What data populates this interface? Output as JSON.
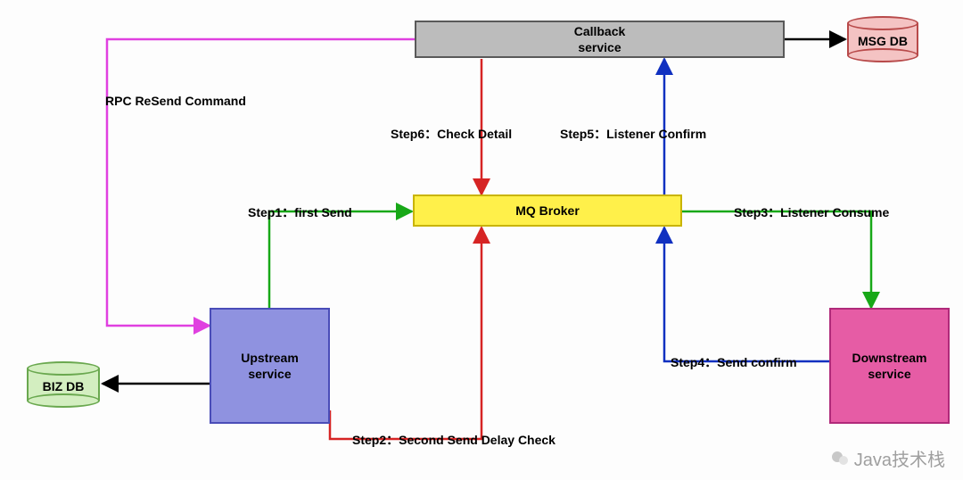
{
  "nodes": {
    "callback": {
      "label": "Callback\nservice"
    },
    "msgdb": {
      "label": "MSG DB"
    },
    "mqbroker": {
      "label": "MQ Broker"
    },
    "upstream": {
      "label": "Upstream\nservice"
    },
    "downstream": {
      "label": "Downstream\nservice"
    },
    "bizdb": {
      "label": "BIZ DB"
    }
  },
  "labels": {
    "rpc": "RPC ReSend Command",
    "step1": "Step1：first Send",
    "step2": "Step2：Second Send Delay Check",
    "step3": "Step3：Listener Consume",
    "step4": "Step4：Send confirm",
    "step5": "Step5：Listener Confirm",
    "step6": "Step6：Check Detail"
  },
  "watermark": "Java技术栈",
  "colors": {
    "callback_fill": "#bcbcbc",
    "callback_stroke": "#595959",
    "msgdb_fill": "#f4c3c3",
    "msgdb_stroke": "#b84a4a",
    "mq_fill": "#fff04a",
    "mq_stroke": "#c9b400",
    "upstream_fill": "#8f92e0",
    "upstream_stroke": "#4a4db8",
    "downstream_fill": "#e65ca5",
    "downstream_stroke": "#b02a7a",
    "bizdb_fill": "#d3eec0",
    "bizdb_stroke": "#6aa84f",
    "line_red": "#d62424",
    "line_green": "#18a818",
    "line_blue": "#1030c0",
    "line_magenta": "#e040e0",
    "line_black": "#000000"
  }
}
